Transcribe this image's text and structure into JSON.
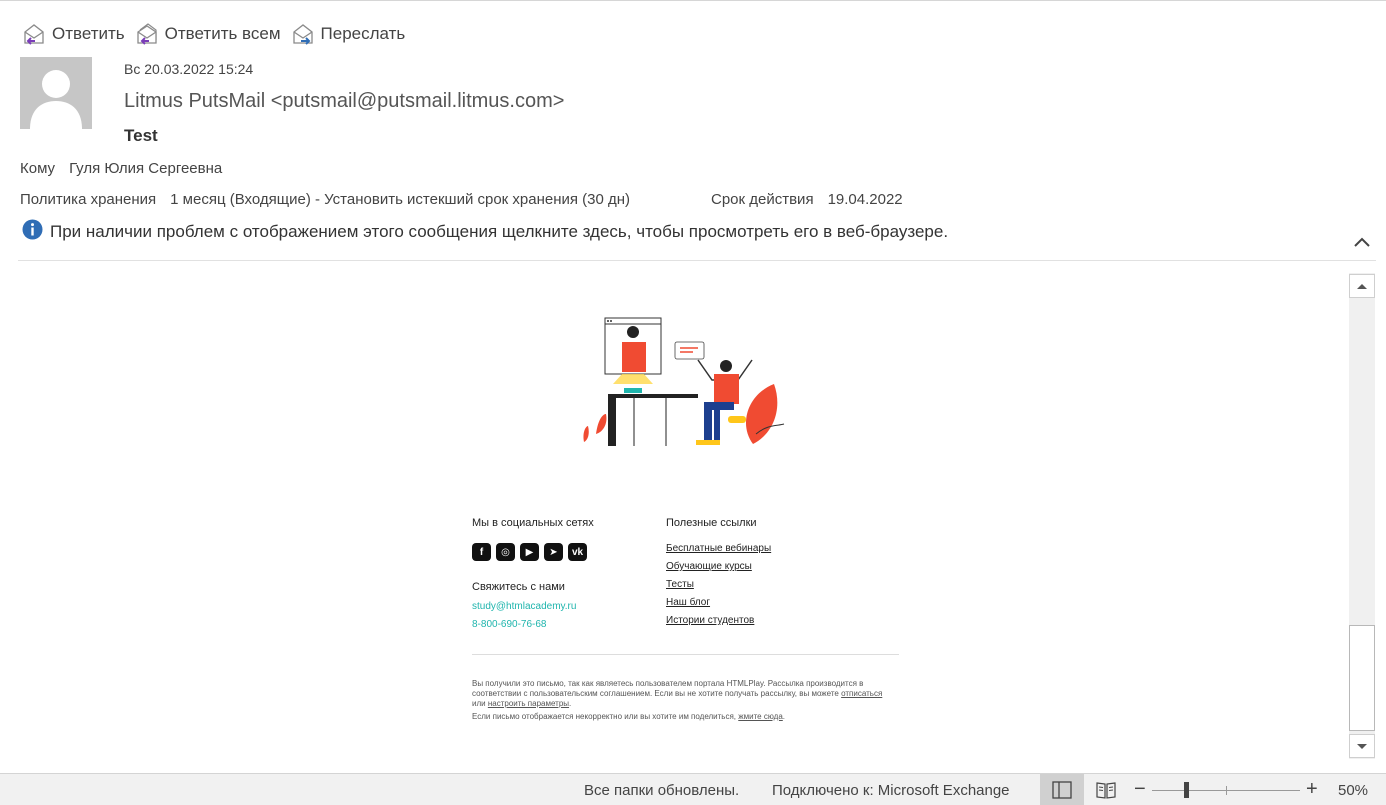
{
  "toolbar": {
    "reply": "Ответить",
    "reply_all": "Ответить всем",
    "forward": "Переслать"
  },
  "message": {
    "datetime": "Вс 20.03.2022 15:24",
    "sender": "Litmus PutsMail <putsmail@putsmail.litmus.com>",
    "subject": "Test",
    "to_label": "Кому",
    "to_value": "Гуля Юлия Сергеевна",
    "policy_label": "Политика хранения",
    "policy_value": "1 месяц (Входящие) - Установить истекший срок хранения (30 дн)",
    "expiry_label": "Срок действия",
    "expiry_value": "19.04.2022",
    "info": "При наличии проблем с отображением этого сообщения щелкните здесь, чтобы просмотреть его в веб-браузере."
  },
  "email_body": {
    "social_heading": "Мы в социальных сетях",
    "social_icons": [
      "f",
      "◎",
      "▶",
      "➤",
      "vk"
    ],
    "contact_heading": "Свяжитесь с нами",
    "email": "study@htmlacademy.ru",
    "phone": "8-800-690-76-68",
    "links_heading": "Полезные ссылки",
    "links": [
      "Бесплатные вебинары",
      "Обучающие курсы",
      "Тесты",
      "Наш блог",
      "Истории студентов"
    ],
    "footer": {
      "p1": "Вы получили это письмо, так как являетесь пользователем портала HTMLPlay. Рассылка производится в соответствии с пользовательским соглашением. Если вы не хотите получать рассылку, вы можете",
      "unsubscribe": "отписаться",
      "or": "или",
      "settings": "настроить параметры",
      "p2": "Если письмо отображается некорректно или вы хотите им поделиться,",
      "click_here": "жмите сюда"
    }
  },
  "statusbar": {
    "folders": "Все папки обновлены.",
    "connection": "Подключено к: Microsoft Exchange",
    "zoom": "50%",
    "zoom_minus": "−",
    "zoom_plus": "+"
  },
  "colors": {
    "accent_teal": "#1fb5ad",
    "illustration_red": "#f04b32",
    "info_blue": "#2f6db5"
  }
}
